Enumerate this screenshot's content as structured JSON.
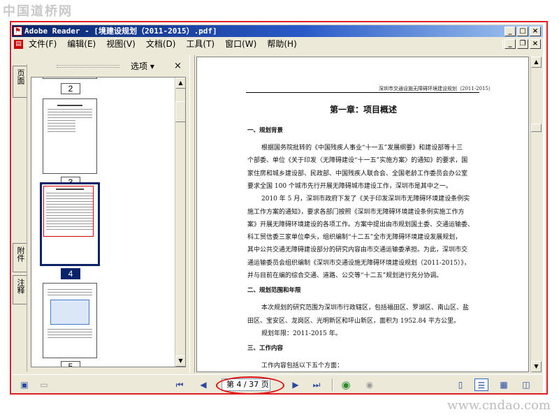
{
  "watermarks": {
    "top_left": "中国道桥网",
    "bottom_right": "www.cndao.com"
  },
  "window": {
    "title": "Adobe Reader - [境建设规划（2011-2015）.pdf]",
    "controls": {
      "minimize": "_",
      "maximize": "□",
      "close": "×",
      "restore": "❐"
    }
  },
  "menubar": {
    "items": [
      "文件(F)",
      "编辑(E)",
      "视图(V)",
      "文档(D)",
      "工具(T)",
      "窗口(W)",
      "帮助(H)"
    ]
  },
  "side_tabs": [
    "页面",
    "附件",
    "注释"
  ],
  "thumbnail_panel": {
    "options_label": "选项 ▾",
    "close_label": "×",
    "page_labels": [
      "2",
      "3",
      "4",
      "5"
    ],
    "selected_page": "4"
  },
  "document": {
    "running_header": "深圳市交通设施无障碍环境建设规划（2011-2015）",
    "chapter_title": "第一章：项目概述",
    "lines": [
      {
        "style": "h",
        "text": "一、规划背景"
      },
      {
        "style": "p",
        "text": "根据国务院批转的《中国残疾人事业“十一五”发展纲要》和建设部等十三"
      },
      {
        "style": "p",
        "text": "个部委、单位《关于印发〈无障碍建设“十一五”实施方案〉的通知》的要求，国"
      },
      {
        "style": "p",
        "text": "家住房和城乡建设部、民政部、中国残疾人联合会、全国老龄工作委员会办公室"
      },
      {
        "style": "p",
        "text": "要求全国 100 个城市先行开展无障碍城市建设工作，深圳市是其中之一。"
      },
      {
        "style": "p",
        "text": "2010 年 5 月，深圳市政府下发了《关于印发深圳市无障碍环境建设条例实"
      },
      {
        "style": "p",
        "text": "施工作方案的通知》，要求各部门按照《深圳市无障碍环境建设条例实施工作方"
      },
      {
        "style": "p",
        "text": "案》开展无障碍环境建设的各项工作。方案中提出由市规划国土委、交通运输委、"
      },
      {
        "style": "p",
        "text": "科工贸信委三家单位牵头，组织编制“十二五”全市无障碍环境建设发展规划，"
      },
      {
        "style": "p",
        "text": "其中公共交通无障碍建设部分的研究内容由市交通运输委承担。为此，深圳市交"
      },
      {
        "style": "p",
        "text": "通运输委员会组织编制《深圳市交通设施无障碍环境建设规划（2011-2015）》，"
      },
      {
        "style": "p",
        "text": "并与目前在编的综合交通、道路、公交等“十二五”规划进行充分协调。"
      },
      {
        "style": "h",
        "text": "二、规划范围和年限"
      },
      {
        "style": "p",
        "text": "本次规划的研究范围为深圳市行政辖区，包括福田区、罗湖区、南山区、盐"
      },
      {
        "style": "p",
        "text": "田区、宝安区、龙岗区、光明新区和坪山新区，面积为 1952.84 平方公里。"
      },
      {
        "style": "p",
        "text": "规划年限：2011-2015 年。"
      },
      {
        "style": "h",
        "text": "三、工作内容"
      },
      {
        "style": "p",
        "text": "工作内容包括以下五个方面："
      }
    ]
  },
  "navigation": {
    "page_display": "第 4 / 37 页",
    "current_page": 4,
    "total_pages": 37
  }
}
